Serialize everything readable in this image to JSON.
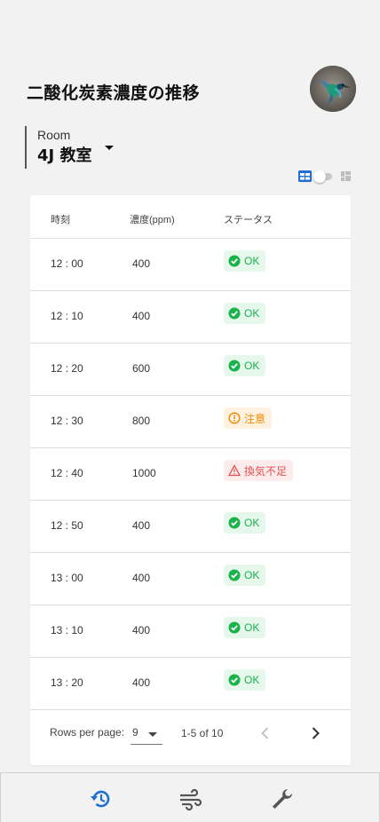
{
  "header": {
    "title": "二酸化炭素濃度の推移",
    "avatar_icon": "hummingbird-avatar"
  },
  "room": {
    "label": "Room",
    "value": "4J 教室"
  },
  "view_toggle": {
    "left_icon": "table-icon",
    "right_icon": "grid-icon",
    "active": "table"
  },
  "table": {
    "columns": [
      "時刻",
      "濃度(ppm)",
      "ステータス"
    ],
    "rows": [
      {
        "time": "12 : 00",
        "ppm": "400",
        "status": "OK",
        "level": "ok"
      },
      {
        "time": "12 : 10",
        "ppm": "400",
        "status": "OK",
        "level": "ok"
      },
      {
        "time": "12 : 20",
        "ppm": "600",
        "status": "OK",
        "level": "ok"
      },
      {
        "time": "12 : 30",
        "ppm": "800",
        "status": "注意",
        "level": "warn"
      },
      {
        "time": "12 : 40",
        "ppm": "1000",
        "status": "換気不足",
        "level": "bad"
      },
      {
        "time": "12 : 50",
        "ppm": "400",
        "status": "OK",
        "level": "ok"
      },
      {
        "time": "13 : 00",
        "ppm": "400",
        "status": "OK",
        "level": "ok"
      },
      {
        "time": "13 : 10",
        "ppm": "400",
        "status": "OK",
        "level": "ok"
      },
      {
        "time": "13 : 20",
        "ppm": "400",
        "status": "OK",
        "level": "ok"
      }
    ]
  },
  "pagination": {
    "rows_per_page_label": "Rows per page:",
    "rows_per_page_value": "9",
    "range": "1-5 of 10"
  },
  "bottom_nav": {
    "items": [
      {
        "icon": "history-icon",
        "active": true
      },
      {
        "icon": "wind-icon",
        "active": false
      },
      {
        "icon": "wrench-icon",
        "active": false
      }
    ]
  },
  "colors": {
    "accent": "#1f6fd1",
    "ok": "#19b24b",
    "warn": "#ef8a00",
    "bad": "#e05252",
    "nav_inactive": "#555555"
  }
}
